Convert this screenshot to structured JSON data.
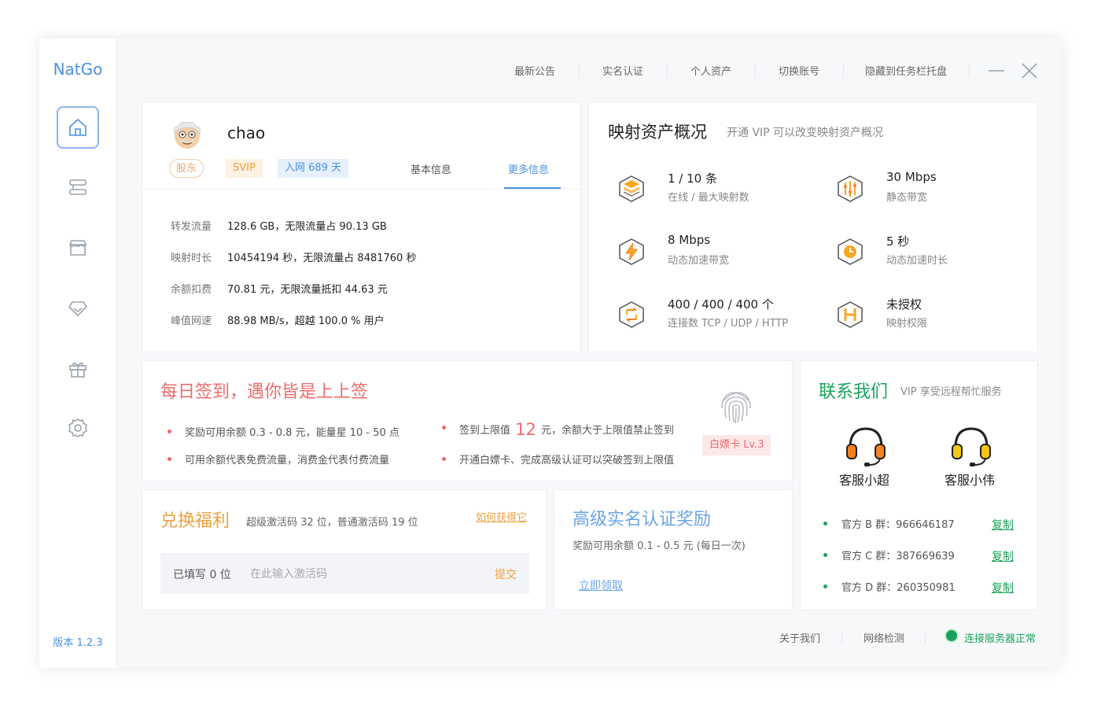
{
  "app": {
    "name": "NatGo",
    "version": "版本 1.2.3"
  },
  "sidebar": {
    "items": [
      {
        "name": "home",
        "icon": "home-icon"
      },
      {
        "name": "mappings",
        "icon": "server-list-icon"
      },
      {
        "name": "store",
        "icon": "store-icon"
      },
      {
        "name": "vip",
        "icon": "diamond-icon"
      },
      {
        "name": "gift",
        "icon": "gift-icon"
      },
      {
        "name": "settings",
        "icon": "gear-icon"
      }
    ]
  },
  "topbar": {
    "links": [
      "最新公告",
      "实名认证",
      "个人资产",
      "切换账号",
      "隐藏到任务栏托盘"
    ]
  },
  "user": {
    "name": "chao",
    "tags": {
      "role": "股东",
      "level": "SVIP",
      "days": "入网 689 天"
    },
    "tabs": [
      "基本信息",
      "更多信息"
    ],
    "active_tab": "更多信息",
    "rows": [
      {
        "k": "转发流量",
        "v": "128.6 GB，无限流量占 90.13 GB"
      },
      {
        "k": "映射时长",
        "v": "10454194 秒，无限流量占 8481760 秒"
      },
      {
        "k": "余额扣费",
        "v": "70.81 元，无限流量抵扣 44.63 元"
      },
      {
        "k": "峰值网速",
        "v": "88.98 MB/s，超越 100.0 % 用户"
      }
    ]
  },
  "assets": {
    "title": "映射资产概况",
    "subtitle": "开通 VIP 可以改变映射资产概况",
    "items": [
      {
        "value": "1 / 10 条",
        "label": "在线 / 最大映射数",
        "icon": "cube-icon"
      },
      {
        "value": "30 Mbps",
        "label": "静态带宽",
        "icon": "bandwidth-icon"
      },
      {
        "value": "8 Mbps",
        "label": "动态加速带宽",
        "icon": "lightning-icon"
      },
      {
        "value": "5 秒",
        "label": "动态加速时长",
        "icon": "clock-icon"
      },
      {
        "value": "400 / 400 / 400 个",
        "label": "连接数 TCP / UDP / HTTP",
        "icon": "connection-icon"
      },
      {
        "value": "未授权",
        "label": "映射权限",
        "icon": "h-permission-icon"
      }
    ]
  },
  "signin": {
    "title": "每日签到，遇你皆是上上签",
    "bullets": {
      "b1": "奖励可用余额 0.3 - 0.8 元，能量星 10 - 50 点",
      "b2_pre": "签到上限值",
      "b2_num": "12",
      "b2_post": "元，余额大于上限值禁止签到",
      "b3": "可用余额代表免费流量，消费金代表付费流量",
      "b4": "开通白嫖卡、完成高级认证可以突破签到上限值"
    },
    "badge": "白嫖卡 Lv.3"
  },
  "redeem": {
    "title": "兑换福利",
    "subtitle": "超级激活码 32 位，普通激活码 19 位",
    "how_link": "如何获得它",
    "filled": "已填写 0 位",
    "placeholder": "在此输入激活码",
    "submit": "提交"
  },
  "verify": {
    "title": "高级实名认证奖励",
    "subtitle": "奖励可用余额 0.1 - 0.5 元 (每日一次)",
    "claim": "立即领取"
  },
  "contact": {
    "title": "联系我们",
    "subtitle": "VIP 享受远程帮忙服务",
    "agents": [
      {
        "name": "客服小超",
        "color": "#f5821f"
      },
      {
        "name": "客服小伟",
        "color": "#f5c518"
      }
    ],
    "groups": [
      {
        "label": "官方 B 群：966646187",
        "copy": "复制"
      },
      {
        "label": "官方 C 群：387669639",
        "copy": "复制"
      },
      {
        "label": "官方 D 群：260350981",
        "copy": "复制"
      }
    ]
  },
  "footer": {
    "about": "关于我们",
    "network": "网络检测",
    "status": "连接服务器正常",
    "status_color": "#1aa35a"
  },
  "colors": {
    "accent": "#4a90e2",
    "signin_red": "#ee6b6b",
    "redeem_orange": "#f0a03c",
    "verify_blue": "#6aa4e8",
    "contact_green": "#1aa35a"
  }
}
